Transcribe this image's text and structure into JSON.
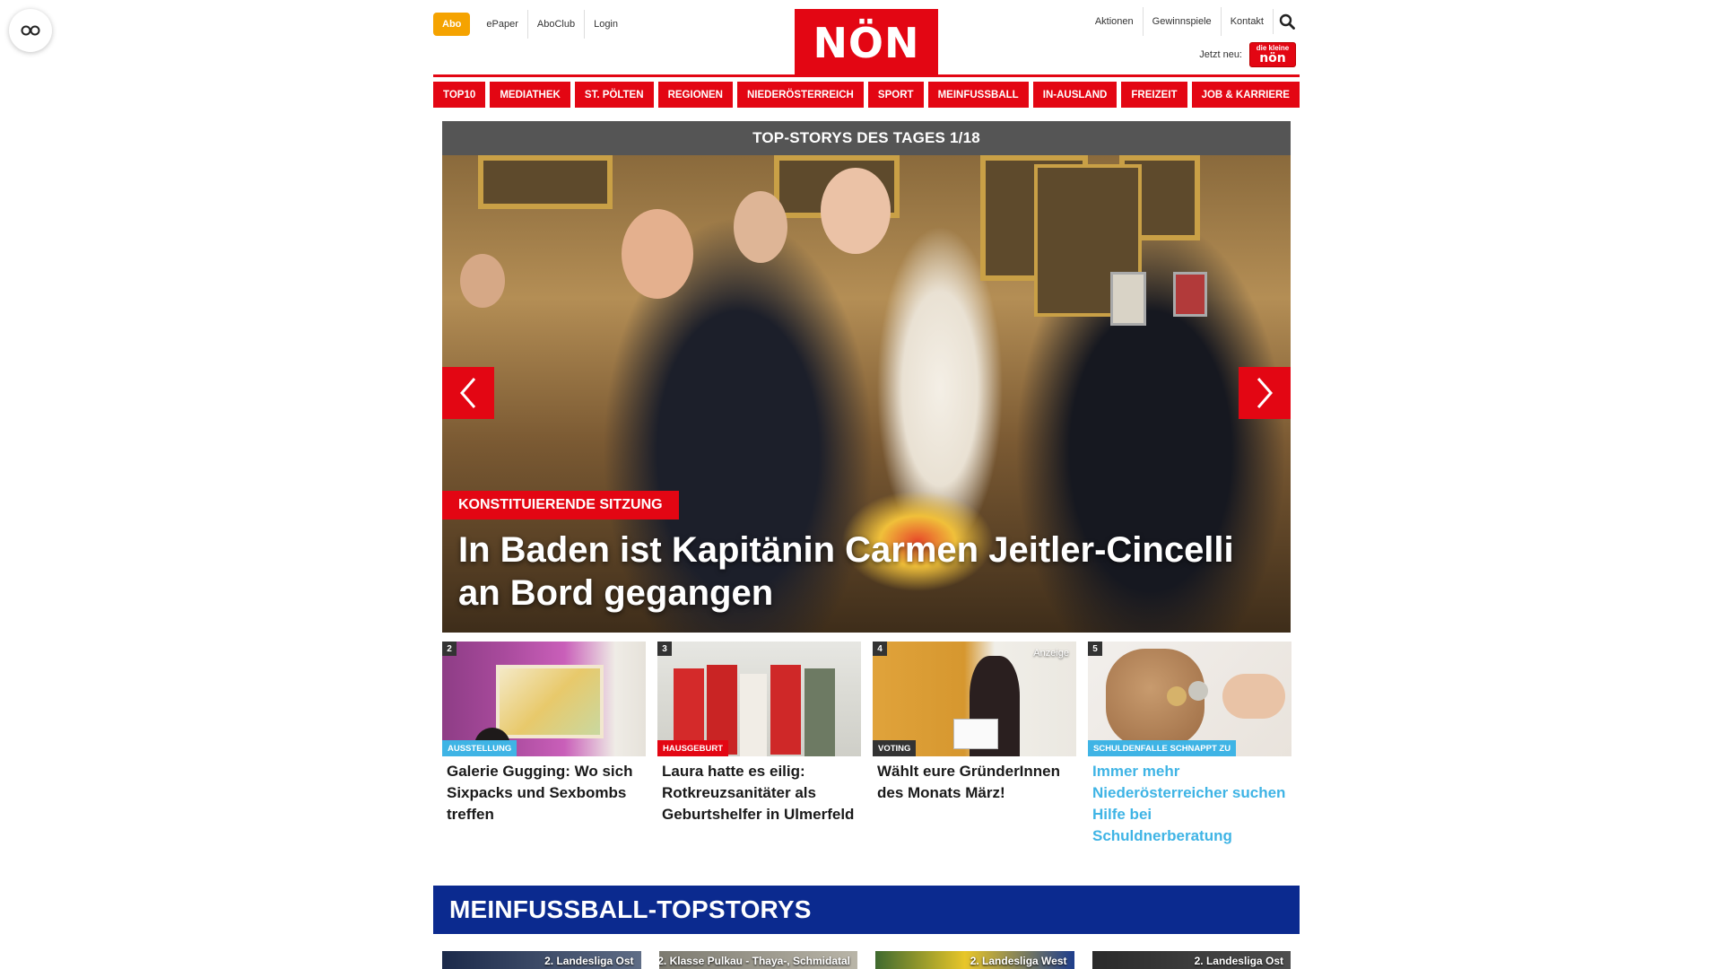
{
  "header": {
    "abo_label": "Abo",
    "left_links": [
      "ePaper",
      "AboClub",
      "Login"
    ],
    "logo_text": "NÖN",
    "right_links": [
      "Aktionen",
      "Gewinnspiele",
      "Kontakt"
    ],
    "jetzt_neu_label": "Jetzt neu:",
    "mini_logo_small": "die kleine",
    "mini_logo_big": "nön"
  },
  "nav": {
    "items": [
      "TOP10",
      "MEDIATHEK",
      "ST. PÖLTEN",
      "REGIONEN",
      "NIEDERÖSTERREICH",
      "SPORT",
      "MEINFUSSBALL",
      "IN-AUSLAND",
      "FREIZEIT",
      "JOB & KARRIERE"
    ]
  },
  "hero": {
    "heading": "TOP-STORYS DES TAGES 1/18",
    "kicker": "KONSTITUIERENDE SITZUNG",
    "title": "In Baden ist Kapitänin Carmen Jeitler-Cincelli an Bord gegangen"
  },
  "cards": [
    {
      "num": "2",
      "tag": "AUSSTELLUNG",
      "tag_color": "#3fb4e5",
      "title": "Galerie Gugging: Wo sich Sixpacks und Sexbombs treffen",
      "ad": ""
    },
    {
      "num": "3",
      "tag": "HAUSGEBURT",
      "tag_color": "#e30613",
      "title": "Laura hatte es eilig: Rotkreuzsanitäter als Geburtshelfer in Ulmerfeld",
      "ad": ""
    },
    {
      "num": "4",
      "tag": "VOTING",
      "tag_color": "#333333",
      "title": "Wählt eure GründerInnen des Monats März!",
      "ad": "Anzeige"
    },
    {
      "num": "5",
      "tag": "SCHULDENFALLE SCHNAPPT ZU",
      "tag_color": "#3fb4e5",
      "title": "Immer mehr Niederösterreicher suchen Hilfe bei Schuldnerberatung",
      "ad": ""
    }
  ],
  "section": {
    "title": "MEINFUSSBALL-TOPSTORYS",
    "cards": [
      "2. Landesliga Ost",
      "2. Klasse Pulkau - Thaya-, Schmidatal",
      "2. Landesliga West",
      "2. Landesliga Ost"
    ]
  },
  "colors": {
    "brand_red": "#e30613",
    "abo_orange": "#f5a300",
    "section_blue": "#0b2a8f",
    "accent_blue": "#3fb4e5"
  }
}
